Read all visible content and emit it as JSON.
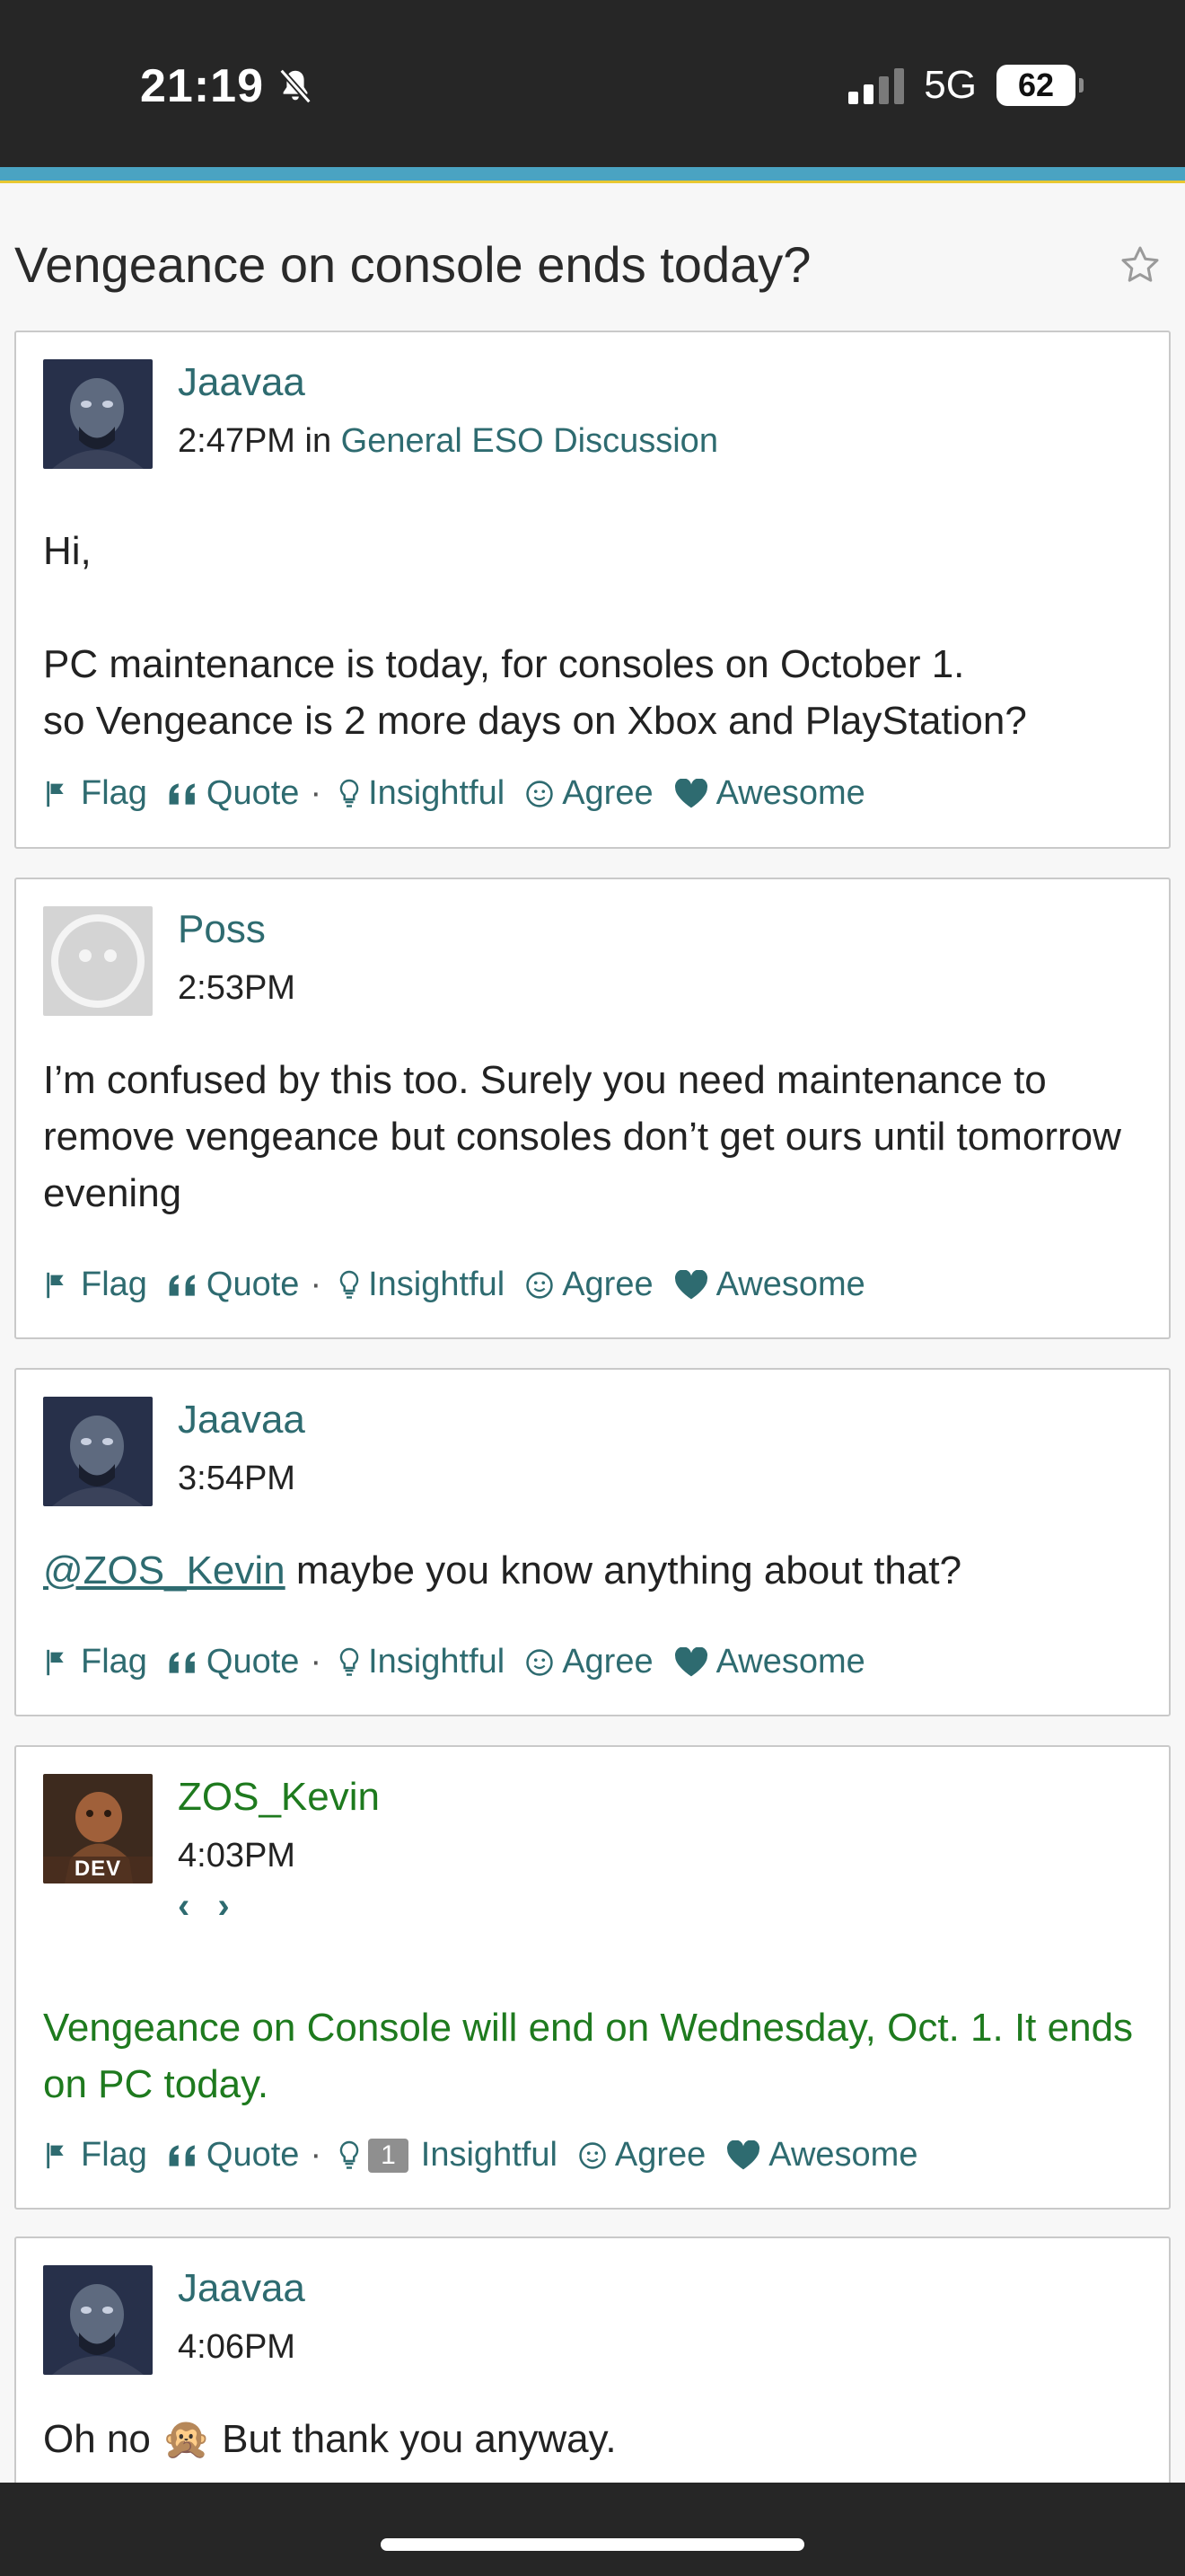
{
  "status_bar": {
    "time": "21:19",
    "network": "5G",
    "battery": "62"
  },
  "thread": {
    "title": "Vengeance on console ends today?"
  },
  "posts": [
    {
      "author": "Jaavaa",
      "time": "2:47PM",
      "in_label": "in",
      "category": "General ESO Discussion",
      "paragraphs": [
        "Hi,",
        "PC maintenance is today, for consoles on October 1.",
        "so Vengeance is 2 more days on Xbox and PlayStation?"
      ]
    },
    {
      "author": "Poss",
      "time": "2:53PM",
      "paragraphs": [
        "I’m confused by this too. Surely you need maintenance to remove vengeance but consoles don’t get ours until tomorrow evening"
      ]
    },
    {
      "author": "Jaavaa",
      "time": "3:54PM",
      "mention": "@ZOS_Kevin",
      "text": " maybe you know anything about that?"
    },
    {
      "author": "ZOS_Kevin",
      "time": "4:03PM",
      "avatar_badge": "DEV",
      "nav": "‹ ›",
      "text": "Vengeance on Console will end on Wednesday, Oct. 1. It ends on PC today.",
      "insightful_count": "1"
    },
    {
      "author": "Jaavaa",
      "time": "4:06PM",
      "text_before": "Oh no ",
      "emoji": "🙊",
      "text_after": " But thank you anyway."
    }
  ],
  "reactions": {
    "flag": "Flag",
    "quote": "Quote",
    "separator": "·",
    "insightful": "Insightful",
    "agree": "Agree",
    "awesome": "Awesome"
  },
  "colors": {
    "link": "#2e6b70",
    "dev": "#1e7a1e",
    "accent": "#4aa3c2"
  }
}
